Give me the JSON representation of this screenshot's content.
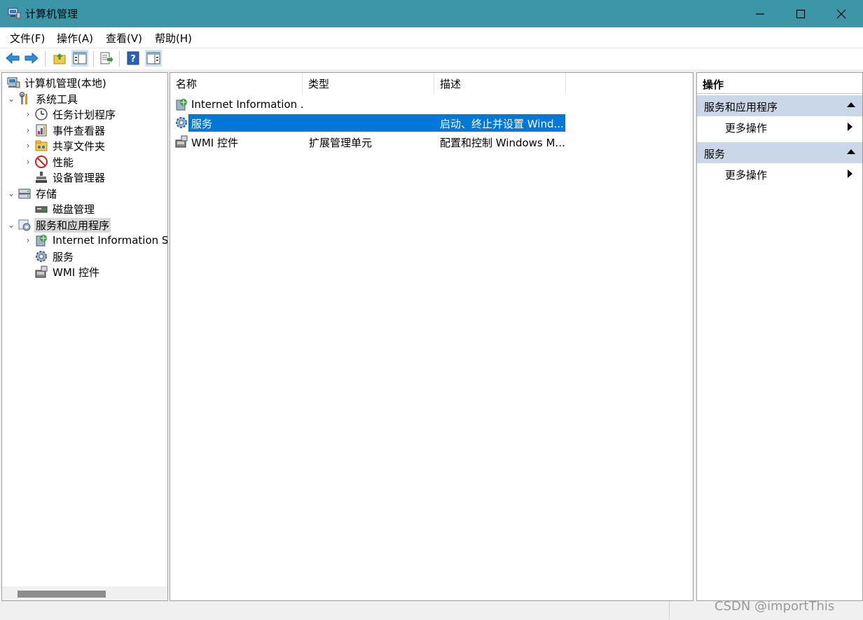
{
  "window": {
    "title": "计算机管理",
    "controls": [
      "minimize-icon",
      "maximize-icon",
      "close-icon"
    ]
  },
  "menu": [
    "文件(F)",
    "操作(A)",
    "查看(V)",
    "帮助(H)"
  ],
  "toolbar": [
    "back-arrow-icon",
    "forward-arrow-icon",
    "up-folder-icon",
    "show-hide-tree-icon",
    "export-list-icon",
    "help-icon",
    "show-hide-action-pane-icon"
  ],
  "tree": {
    "root": "计算机管理(本地)",
    "system_tools": "系统工具",
    "task_scheduler": "任务计划程序",
    "event_viewer": "事件查看器",
    "shared_folders": "共享文件夹",
    "performance": "性能",
    "device_manager": "设备管理器",
    "storage": "存储",
    "disk_management": "磁盘管理",
    "services_apps": "服务和应用程序",
    "iis": "Internet Information Se",
    "services": "服务",
    "wmi": "WMI 控件"
  },
  "list": {
    "columns": [
      "名称",
      "类型",
      "描述"
    ],
    "rows": [
      {
        "name": "Internet Information ...",
        "type": "",
        "desc": ""
      },
      {
        "name": "服务",
        "type": "",
        "desc": "启动、终止并设置 Wind..."
      },
      {
        "name": "WMI 控件",
        "type": "扩展管理单元",
        "desc": "配置和控制 Windows M..."
      }
    ]
  },
  "actions": {
    "title": "操作",
    "sections": [
      {
        "header": "服务和应用程序",
        "item": "更多操作"
      },
      {
        "header": "服务",
        "item": "更多操作"
      }
    ]
  },
  "watermark": "CSDN @importThis",
  "colors": {
    "titlebar": "#3d95a8",
    "selection": "#0078d7",
    "action_header": "#c9d7e8"
  }
}
